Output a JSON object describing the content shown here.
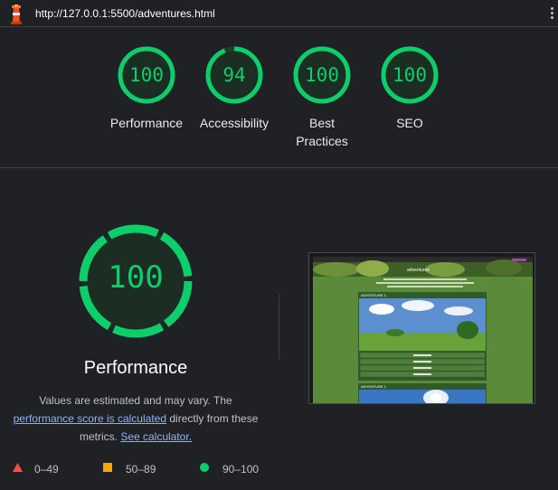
{
  "address_bar": {
    "url": "http://127.0.0.1:5500/adventures.html"
  },
  "colors": {
    "pass": "#0cce6b",
    "average": "#ffa400",
    "fail": "#ff4e42",
    "link": "#8ab4f8"
  },
  "gauges": [
    {
      "score": "100",
      "label": "Performance",
      "label_line2": "",
      "fraction": 1.0
    },
    {
      "score": "94",
      "label": "Accessibility",
      "label_line2": "",
      "fraction": 0.94
    },
    {
      "score": "100",
      "label": "Best",
      "label_line2": "Practices",
      "fraction": 1.0
    },
    {
      "score": "100",
      "label": "SEO",
      "label_line2": "",
      "fraction": 1.0
    }
  ],
  "performance": {
    "score": "100",
    "title": "Performance",
    "desc_part1": "Values are estimated and may vary. The",
    "desc_link1": "performance score is calculated",
    "desc_part2": "directly from these metrics.",
    "desc_link2": "See calculator."
  },
  "legend": [
    {
      "icon": "triangle-icon",
      "range": "0–49"
    },
    {
      "icon": "square-icon",
      "range": "50–89"
    },
    {
      "icon": "circle-icon",
      "range": "90–100"
    }
  ],
  "screenshot": {
    "nav": "adventures",
    "heading_1": "ADVENTURE 1",
    "heading_2": "ADVENTURE 1"
  }
}
